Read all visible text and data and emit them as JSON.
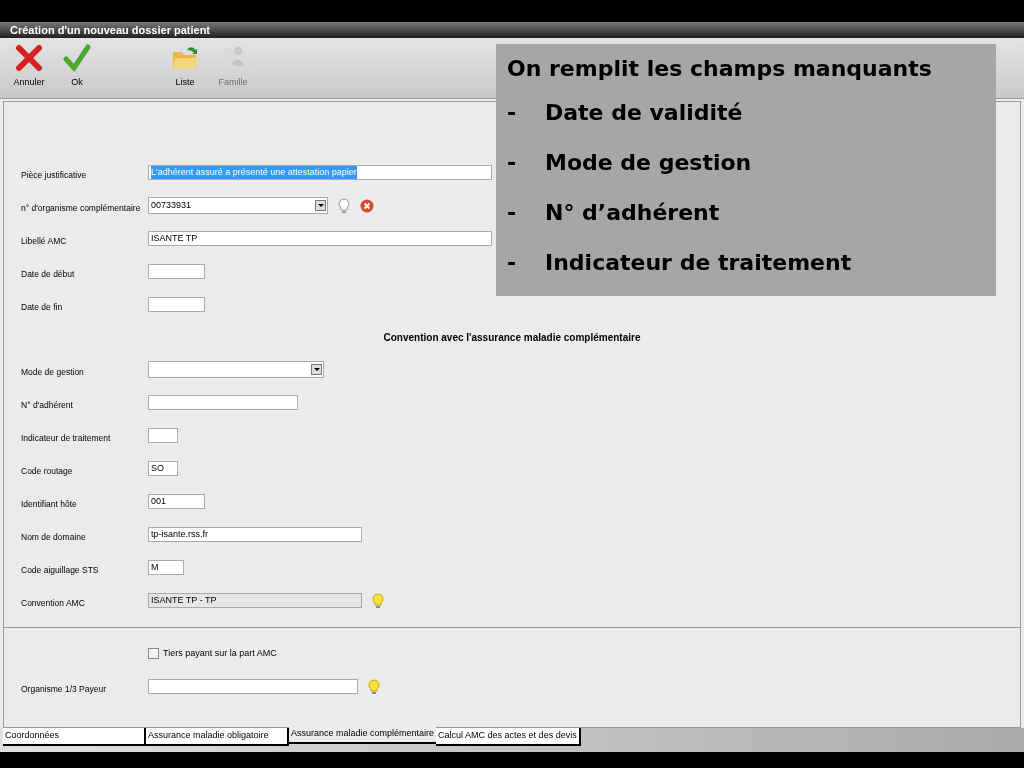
{
  "window": {
    "title": "Création d'un nouveau dossier patient"
  },
  "toolbar": [
    {
      "label": "Annuler",
      "kind": "cancel",
      "disabled": false
    },
    {
      "label": "Ok",
      "kind": "ok",
      "disabled": false
    },
    {
      "label": "Liste",
      "kind": "folder",
      "disabled": false
    },
    {
      "label": "Famille",
      "kind": "people",
      "disabled": true
    }
  ],
  "form": [
    {
      "kind": "field",
      "label": "Pièce justificative",
      "value": "L'adhérent assuré a présenté une attestation papier",
      "highlighted": true
    },
    {
      "kind": "combo",
      "label": "n° d'organisme complémentaire",
      "value": "00733931",
      "icons": [
        {
          "kind": "bulb"
        },
        {
          "kind": "delete"
        }
      ]
    },
    {
      "kind": "field",
      "label": "Libellé AMC",
      "value": "ISANTE TP"
    },
    {
      "kind": "field",
      "label": "Date de début"
    },
    {
      "kind": "field",
      "label": "Date de fin"
    },
    {
      "kind": "heading",
      "label": "Convention avec l'assurance maladie complémentaire"
    },
    {
      "kind": "combo",
      "label": "Mode de gestion"
    },
    {
      "kind": "field",
      "label": "N° d'adhérent"
    },
    {
      "kind": "field",
      "label": "Indicateur de traitement"
    },
    {
      "kind": "field",
      "label": "Code routage",
      "value": "SO"
    },
    {
      "kind": "field",
      "label": "Identifiant hôte",
      "value": "001"
    },
    {
      "kind": "field",
      "label": "Nom de domaine",
      "value": "tp-isante.rss.fr"
    },
    {
      "kind": "field",
      "label": "Code aiguillage STS",
      "value": "M"
    },
    {
      "kind": "field",
      "label": "Convention AMC",
      "value": "ISANTE TP - TP",
      "readonly": true,
      "icons": [
        {
          "kind": "bulb-lit"
        }
      ]
    },
    {
      "kind": "divider"
    },
    {
      "kind": "checkbox",
      "label": "Tiers payant sur la part AMC",
      "checked": false
    },
    {
      "kind": "field",
      "label": "Organisme 1/3 Payeur",
      "icons": [
        {
          "kind": "bulb-lit"
        }
      ]
    }
  ],
  "tabs": [
    {
      "label": "Coordonnées",
      "selected": false
    },
    {
      "label": "Assurance maladie obligatoire",
      "selected": false
    },
    {
      "label": "Assurance maladie complémentaire",
      "selected": true
    },
    {
      "label": "Calcul AMC des actes et des devis",
      "selected": false
    }
  ],
  "callout": {
    "title": "On remplit les champs manquants",
    "items": [
      {
        "bullet": "-",
        "text": "Date de validité"
      },
      {
        "bullet": "-",
        "text": "Mode de gestion"
      },
      {
        "bullet": "-",
        "text": "N° d’adhérent"
      },
      {
        "bullet": "-",
        "text": "Indicateur de traitement"
      }
    ]
  }
}
